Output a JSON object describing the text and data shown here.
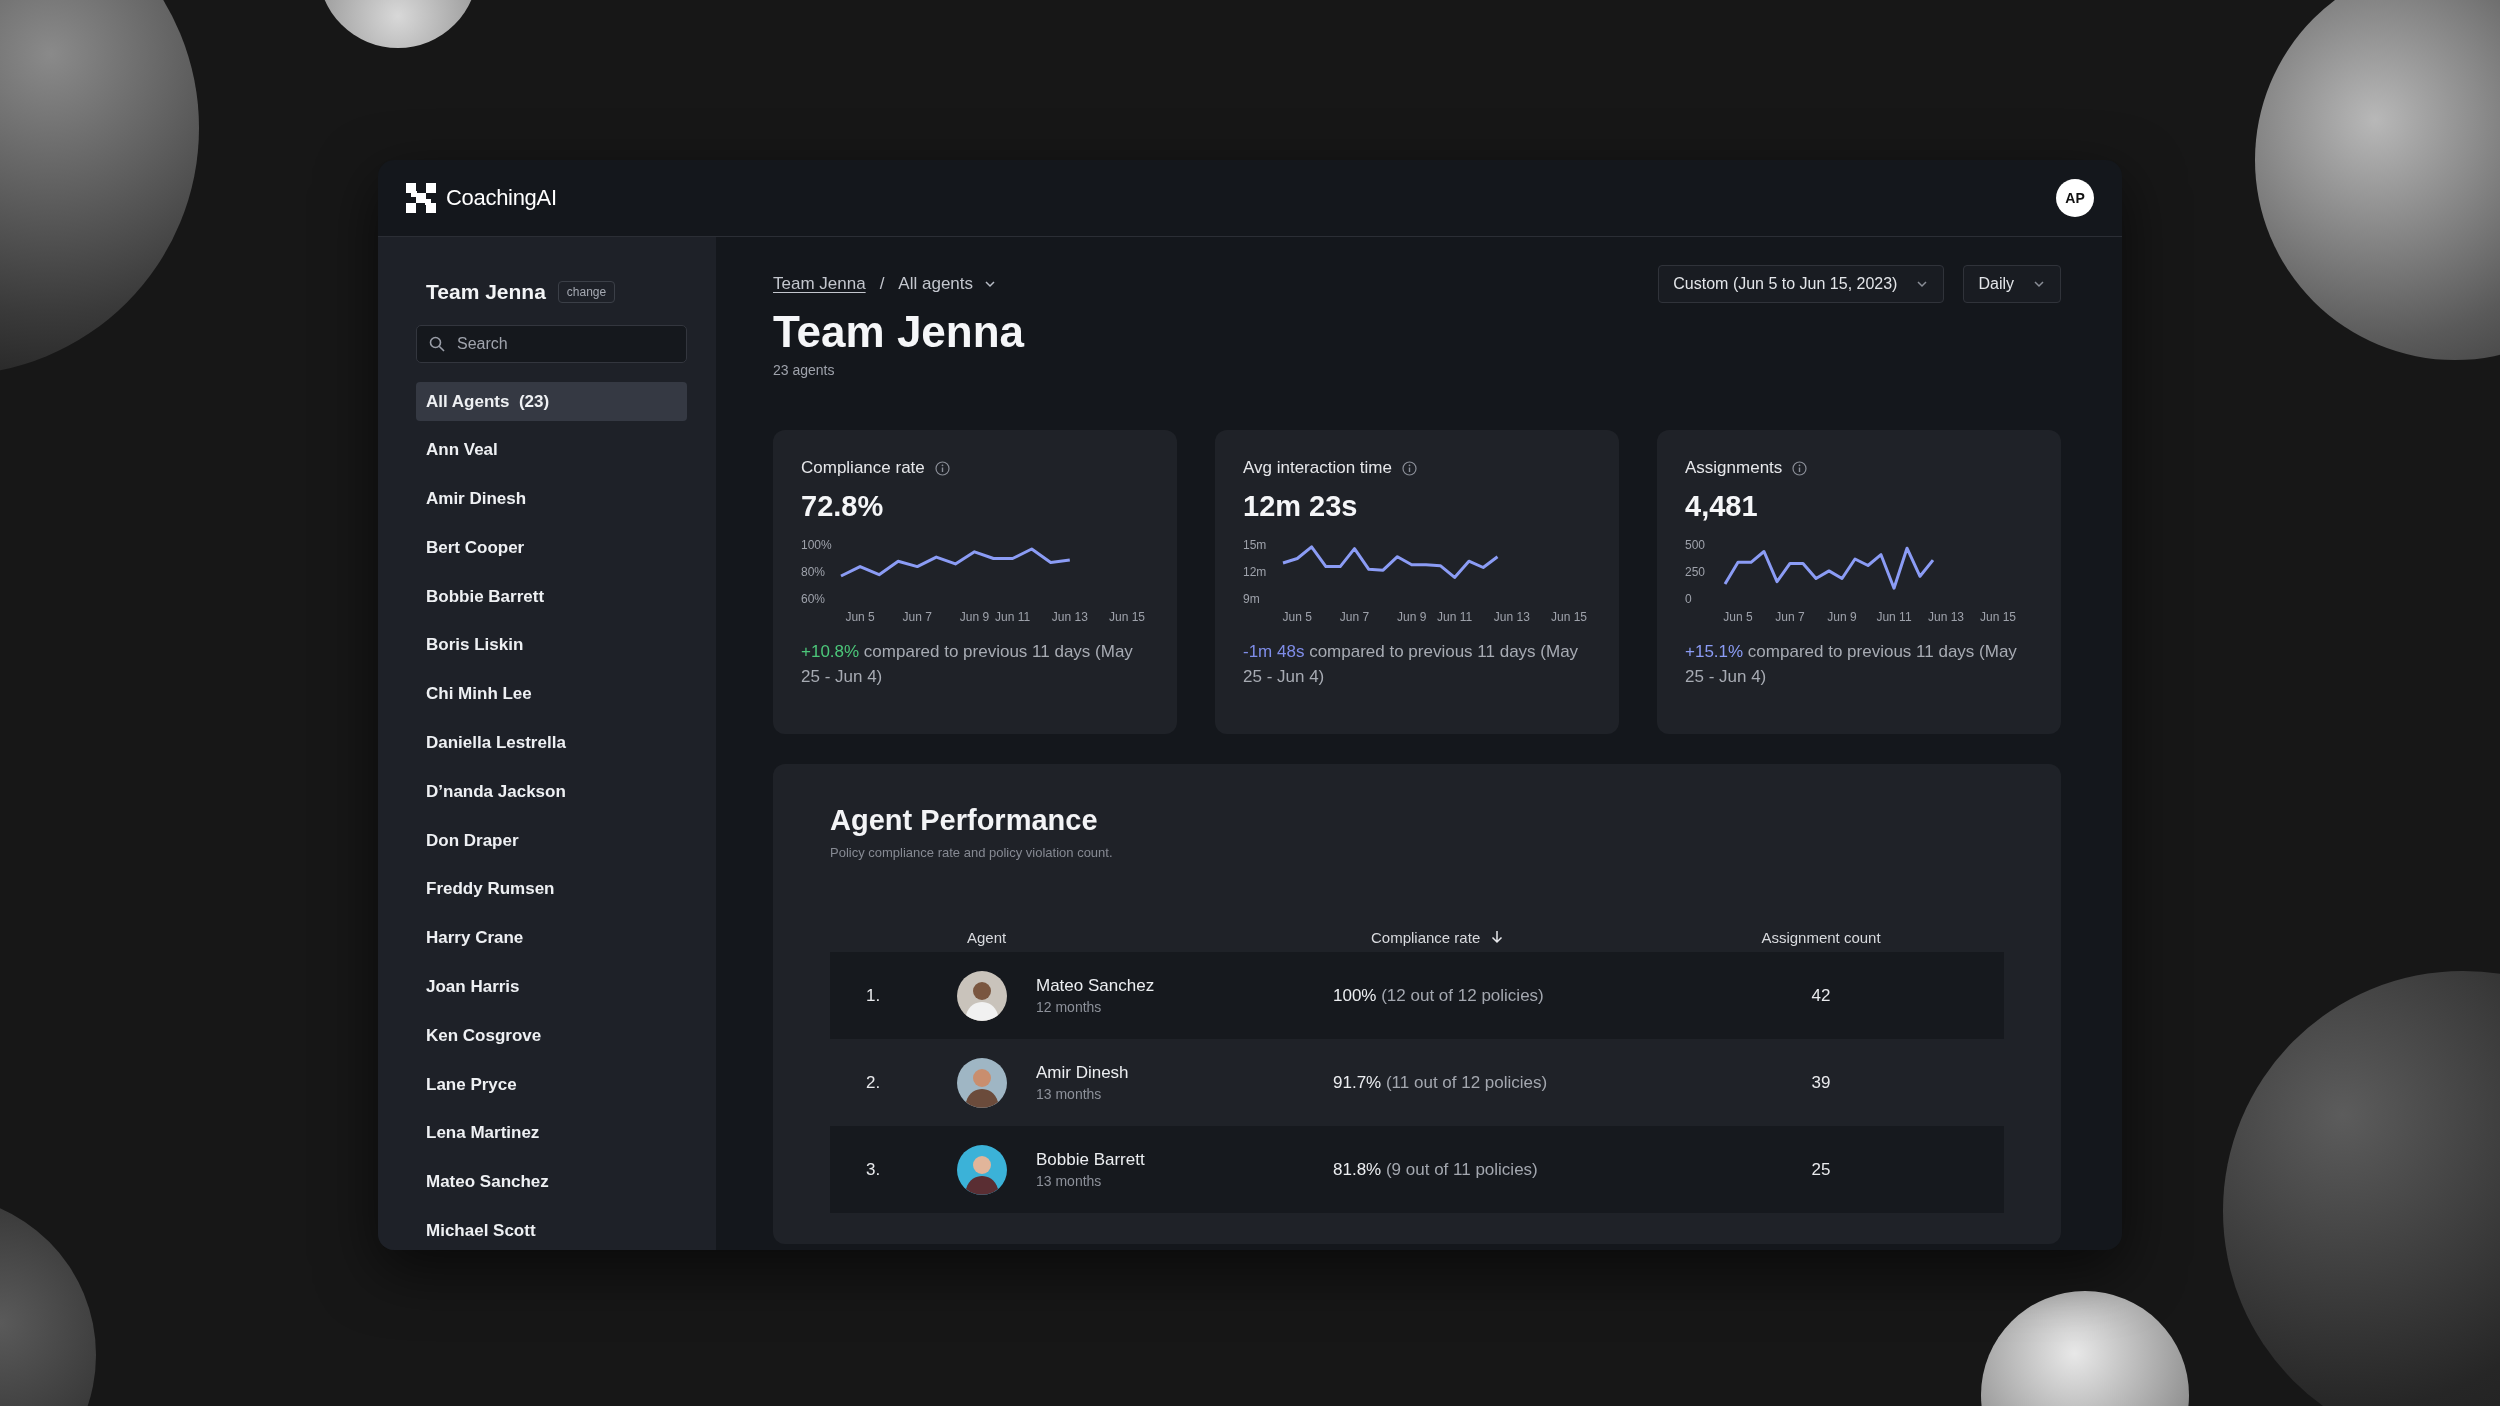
{
  "app": {
    "logo": "**Coaching**AI",
    "user_initials": "AP"
  },
  "sidebar": {
    "team": "Team Jenna",
    "change_label": "change",
    "search": {
      "placeholder": "Search"
    },
    "items": [
      {
        "label": "All Agents  (23)",
        "selected": true
      },
      {
        "label": "Ann Veal",
        "selected": false
      },
      {
        "label": "Amir Dinesh",
        "selected": false
      },
      {
        "label": "Bert Cooper",
        "selected": false
      },
      {
        "label": "Bobbie Barrett",
        "selected": false
      },
      {
        "label": "Boris Liskin",
        "selected": false
      },
      {
        "label": "Chi Minh Lee",
        "selected": false
      },
      {
        "label": "Daniella Lestrella",
        "selected": false
      },
      {
        "label": "D’nanda Jackson",
        "selected": false
      },
      {
        "label": "Don Draper",
        "selected": false
      },
      {
        "label": "Freddy Rumsen",
        "selected": false
      },
      {
        "label": "Harry Crane",
        "selected": false
      },
      {
        "label": "Joan Harris",
        "selected": false
      },
      {
        "label": "Ken Cosgrove",
        "selected": false
      },
      {
        "label": "Lane Pryce",
        "selected": false
      },
      {
        "label": "Lena Martinez",
        "selected": false
      },
      {
        "label": "Mateo Sanchez",
        "selected": false
      },
      {
        "label": "Michael Scott",
        "selected": false
      }
    ]
  },
  "breadcrumb": {
    "items": [
      {
        "label": "Team Jenna",
        "kind": "link"
      },
      {
        "label": "All agents",
        "kind": "dropdown"
      }
    ],
    "separator": "/"
  },
  "filters": [
    {
      "label": "Custom (Jun 5 to Jun 15, 2023)"
    },
    {
      "label": "Daily"
    }
  ],
  "title": "Team Jenna",
  "subtitle": "23 agents",
  "metrics": [
    {
      "label": "Compliance rate",
      "value": "72.8%",
      "change": "+10.8%",
      "color": "#4cc77a",
      "comparison": "compared to previous 11 days (May 25 - Jun 4)",
      "chart_data": {
        "type": "line",
        "categories": [
          null,
          "Jun 5",
          null,
          null,
          "Jun 7",
          null,
          null,
          "Jun 9",
          null,
          "Jun 11",
          null,
          null,
          "Jun 13",
          null,
          null,
          "Jun 15"
        ],
        "series": [
          {
            "color": "#8b9cf5",
            "values": [
              77,
              84,
              78,
              88,
              84,
              91,
              86,
              95,
              90,
              90,
              97,
              87,
              89,
              null,
              null,
              null
            ]
          }
        ],
        "ylim": [
          60,
          100
        ],
        "yticks": [
          {
            "value": 100,
            "label": "100%"
          },
          {
            "value": 80,
            "label": "80%"
          },
          {
            "value": 60,
            "label": "60%"
          }
        ]
      }
    },
    {
      "label": "Avg interaction time",
      "value": "12m 23s",
      "change": "-1m 48s",
      "color": "#7f8de8",
      "comparison": "compared to previous 11 days (May 25 - Jun 4)",
      "chart_data": {
        "type": "line",
        "categories": [
          null,
          "Jun 5",
          null,
          null,
          null,
          "Jun 7",
          null,
          null,
          null,
          "Jun 9",
          null,
          null,
          "Jun 11",
          null,
          null,
          null,
          "Jun 13",
          null,
          null,
          null,
          "Jun 15"
        ],
        "series": [
          {
            "color": "#8b9cf5",
            "values": [
              13.0,
              13.5,
              14.8,
              12.6,
              12.6,
              14.6,
              12.3,
              12.2,
              13.7,
              12.8,
              12.8,
              12.7,
              11.4,
              13.2,
              12.5,
              13.7,
              null,
              null,
              null,
              null,
              null
            ]
          }
        ],
        "ylim": [
          9,
          15
        ],
        "yticks": [
          {
            "value": 15,
            "label": "15m"
          },
          {
            "value": 12,
            "label": "12m"
          },
          {
            "value": 9,
            "label": "9m"
          }
        ]
      }
    },
    {
      "label": "Assignments",
      "value": "4,481",
      "change": "+15.1%",
      "color": "#8b9cf5",
      "comparison": "compared to previous 11 days (May 25 - Jun 4)",
      "chart_data": {
        "type": "line",
        "categories": [
          null,
          "Jun 5",
          null,
          null,
          null,
          "Jun 7",
          null,
          null,
          null,
          "Jun 9",
          null,
          null,
          null,
          "Jun 11",
          null,
          null,
          null,
          "Jun 13",
          null,
          null,
          null,
          "Jun 15",
          null
        ],
        "series": [
          {
            "color": "#8b9cf5",
            "values": [
              140,
              340,
              340,
              440,
              160,
              330,
              330,
              190,
              260,
              190,
              370,
              310,
              410,
              100,
              470,
              210,
              360,
              null,
              null,
              null,
              null,
              null,
              null
            ]
          }
        ],
        "ylim": [
          0,
          500
        ],
        "yticks": [
          500,
          250,
          0
        ]
      }
    }
  ],
  "performance": {
    "title": "Agent Performance",
    "subtitle": "Policy compliance rate and policy violation count.",
    "columns": [
      {
        "label": "Agent",
        "sorted": false
      },
      {
        "label": "Compliance rate",
        "sorted": true
      },
      {
        "label": "Assignment count",
        "sorted": false
      }
    ],
    "rows": [
      {
        "rank": "1.",
        "name": "Mateo Sanchez",
        "tenure": "12 months",
        "rate": "100%",
        "detail": "(12 out of 12 policies)",
        "count": "42"
      },
      {
        "rank": "2.",
        "name": "Amir Dinesh",
        "tenure": "13 months",
        "rate": "91.7%",
        "detail": "(11 out of 12 policies)",
        "count": "39"
      },
      {
        "rank": "3.",
        "name": "Bobbie Barrett",
        "tenure": "13 months",
        "rate": "81.8%",
        "detail": "(9 out of 11 policies)",
        "count": "25"
      }
    ]
  }
}
